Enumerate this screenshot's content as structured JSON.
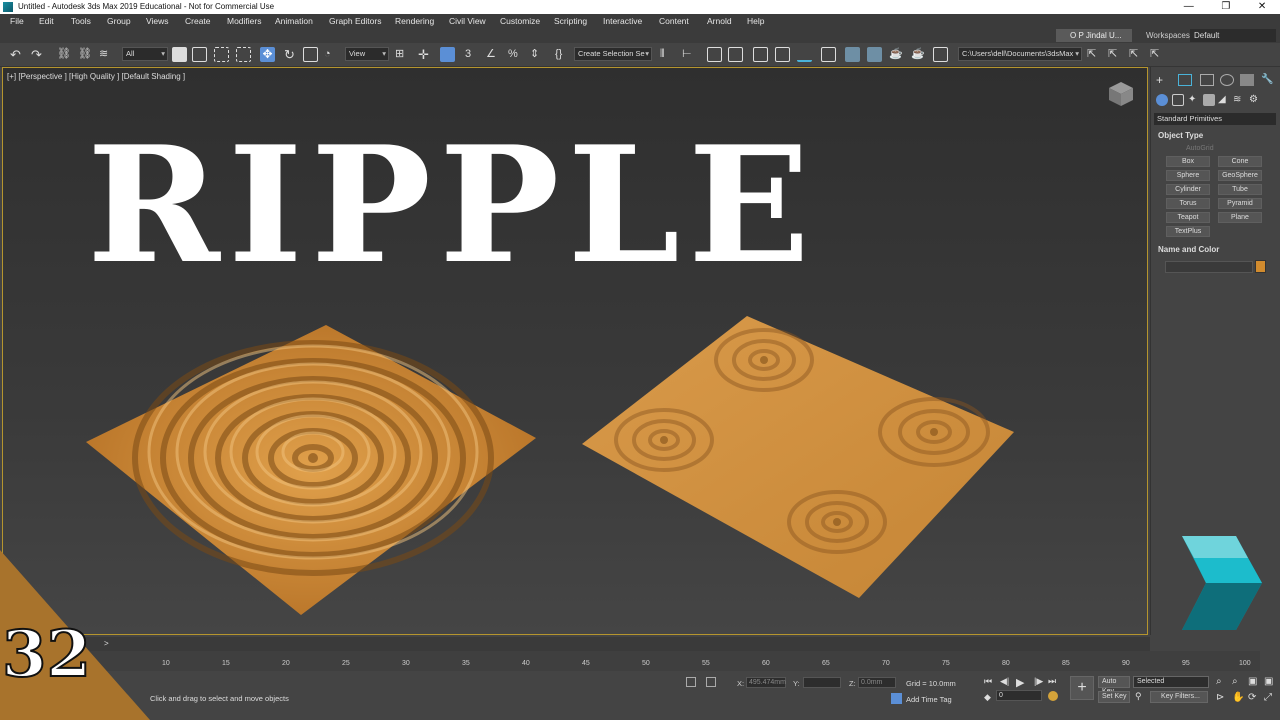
{
  "window": {
    "title": "Untitled - Autodesk 3ds Max 2019 Educational - Not for Commercial Use",
    "controls": [
      "—",
      "❐",
      "✕"
    ]
  },
  "menu": {
    "items": [
      "File",
      "Edit",
      "Tools",
      "Group",
      "Views",
      "Create",
      "Modifiers",
      "Animation",
      "Graph Editors",
      "Rendering",
      "Civil View",
      "Customize",
      "Scripting",
      "Interactive",
      "Content",
      "Arnold",
      "Help"
    ],
    "user": "O P Jindal U...",
    "workspaces_label": "Workspaces:",
    "workspaces_value": "Default"
  },
  "toolbar": {
    "filter": "All",
    "ref_coord": "View",
    "selection_set": "Create Selection Se",
    "project_path": "C:\\Users\\dell\\Documents\\3dsMax"
  },
  "viewport": {
    "label": "[+] [Perspective ] [High Quality ] [Default Shading ]",
    "overlay_title": "RIPPLE",
    "surface_color": "#c9852f"
  },
  "command_panel": {
    "category": "Standard Primitives",
    "object_type_title": "Object Type",
    "autogrid": "AutoGrid",
    "primitives": [
      "Box",
      "Cone",
      "Sphere",
      "GeoSphere",
      "Cylinder",
      "Tube",
      "Torus",
      "Pyramid",
      "Teapot",
      "Plane",
      "TextPlus"
    ],
    "name_color_title": "Name and Color",
    "object_color": "#d18b2e"
  },
  "timeline": {
    "ticks": [
      "10",
      "15",
      "20",
      "25",
      "30",
      "35",
      "40",
      "45",
      "50",
      "55",
      "60",
      "65",
      "70",
      "75",
      "80",
      "85",
      "90",
      "95",
      "100"
    ],
    "arrow": ">"
  },
  "status": {
    "prompt": "Click and drag to select and move objects",
    "x_label": "X:",
    "x_value": "495.474mm",
    "y_label": "Y:",
    "z_label": "Z:",
    "z_value": "0.0mm",
    "grid": "Grid = 10.0mm",
    "add_time_tag": "Add Time Tag",
    "frame": "0",
    "auto_key": "Auto Key",
    "set_key": "Set Key",
    "selected": "Selected",
    "key_filters": "Key Filters..."
  },
  "badge": {
    "number": "32",
    "color": "#a8732c"
  }
}
